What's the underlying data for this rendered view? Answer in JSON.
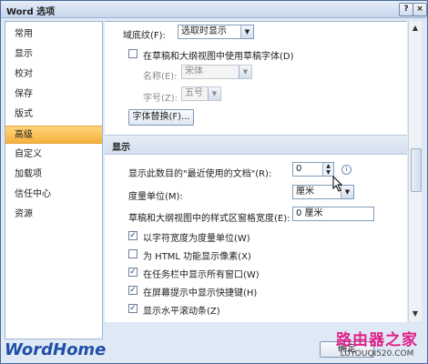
{
  "window": {
    "title": "Word 选项",
    "help": "?",
    "close": "×"
  },
  "sidebar": {
    "items": [
      {
        "label": "常用"
      },
      {
        "label": "显示"
      },
      {
        "label": "校对"
      },
      {
        "label": "保存"
      },
      {
        "label": "版式"
      },
      {
        "label": "高级"
      },
      {
        "label": "自定义"
      },
      {
        "label": "加载项"
      },
      {
        "label": "信任中心"
      },
      {
        "label": "资源"
      }
    ],
    "active_index": 5
  },
  "content": {
    "field_shading": {
      "label": "域底纹(F):",
      "value": "选取时显示"
    },
    "draft_font": {
      "label": "在草稿和大纲视图中使用草稿字体(D)",
      "checked": false
    },
    "font_name": {
      "label": "名称(E):",
      "value": "宋体"
    },
    "font_size": {
      "label": "字号(Z):",
      "value": "五号"
    },
    "font_substitution_button": "字体替换(F)...",
    "display_section": "显示",
    "recent_docs": {
      "label": "显示此数目的\"最近使用的文档\"(R):",
      "value": "0"
    },
    "units": {
      "label": "度量单位(M):",
      "value": "厘米"
    },
    "style_width": {
      "label": "草稿和大纲视图中的样式区窗格宽度(E):",
      "value": "0 厘米"
    },
    "checkboxes": [
      {
        "label": "以字符宽度为度量单位(W)",
        "checked": true
      },
      {
        "label": "为 HTML 功能显示像素(X)",
        "checked": false
      },
      {
        "label": "在任务栏中显示所有窗口(W)",
        "checked": true
      },
      {
        "label": "在屏幕提示中显示快捷键(H)",
        "checked": true
      },
      {
        "label": "显示水平滚动条(Z)",
        "checked": true
      }
    ]
  },
  "footer": {
    "brand": "WordHome",
    "ok": "确定"
  },
  "watermark": {
    "line1": "路由器之家",
    "line2": "LUYOUQI520.COM"
  }
}
